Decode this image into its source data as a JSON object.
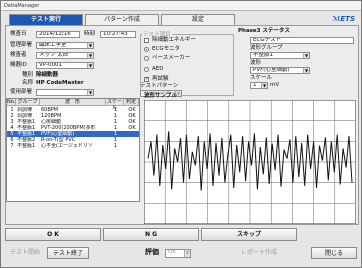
{
  "window": {
    "title": "DeltaManager"
  },
  "tabs": [
    {
      "label": "テスト実行"
    },
    {
      "label": "パターン作成"
    },
    {
      "label": "設定"
    }
  ],
  "logo": "ℳETS",
  "form": {
    "date_label": "検査日",
    "date": "2014/12/16",
    "time_label": "時刻",
    "time": "10:27:43",
    "place_label": "管理部署",
    "place": "臨床工学室",
    "inspector_label": "検査者",
    "inspector": "メッツ 太郎",
    "device_no_label": "機器ID",
    "device_no": "VP-0001",
    "type_label": "種別",
    "type": "除細動器",
    "name_label": "名称",
    "name": "HP CodeMaster",
    "dept_label": "使用部署",
    "dept": ""
  },
  "test_items": {
    "group_label": "テスト項目",
    "items": [
      {
        "label": "除細動エネルギー",
        "checked": false
      },
      {
        "label": "ECGモニタ",
        "checked": true
      },
      {
        "label": "ペースメーカー",
        "checked": false
      },
      {
        "label": "AED",
        "checked": false
      },
      {
        "label": "再試験",
        "checked": true
      }
    ],
    "pattern_label": "テストパターン",
    "pattern": "全項目詳細"
  },
  "phase3": {
    "title": "Phase3 ステータス",
    "status": "ECGテスト",
    "waveform_group_label": "波形グループ",
    "waveform_group": "不整脈1",
    "waveform_label": "波形",
    "waveform": "PVF(心室細動)",
    "scale_label": "スケール",
    "scale": "1",
    "scale_unit": "mV"
  },
  "waveform_sample_label": "波形サンプル",
  "table": {
    "headers": [
      "No.",
      "グループ",
      "波　形",
      "スケール",
      "判定"
    ],
    "rows": [
      {
        "no": "1",
        "group": "洞調律",
        "wave": "60BPM",
        "scale": "1",
        "result": "OK",
        "selected": false
      },
      {
        "no": "2",
        "group": "洞調律",
        "wave": "120BPM",
        "scale": "1",
        "result": "OK",
        "selected": false
      },
      {
        "no": "3",
        "group": "不整脈1",
        "wave": "心房細動",
        "scale": "1",
        "result": "OK",
        "selected": false
      },
      {
        "no": "4",
        "group": "不整脈1",
        "wave": "PVT-200(200BPM)多形",
        "scale": "1",
        "result": "OK",
        "selected": false
      },
      {
        "no": "5",
        "group": "不整脈1",
        "wave": "PVF(心室細動)",
        "scale": "1",
        "result": "",
        "selected": true
      },
      {
        "no": "6",
        "group": "不整脈2",
        "wave": "R-on-T(型 PVC",
        "scale": "1",
        "result": "",
        "selected": false
      },
      {
        "no": "7",
        "group": "不整脈1",
        "wave": "心不全(エージェドリゾ",
        "scale": "1",
        "result": "",
        "selected": false
      }
    ]
  },
  "buttons": {
    "ok": "O K",
    "ng": "N G",
    "skip": "スキップ"
  },
  "footer": {
    "start": "テスト開始",
    "end": "テスト終了",
    "eval_label": "評価",
    "eval_value": "OK",
    "report": "レポート作成",
    "close": "閉じる"
  },
  "chart_data": {
    "type": "line",
    "title": "",
    "xlabel": "",
    "ylabel": "",
    "grid": true,
    "ylim": [
      -1,
      1
    ],
    "series": [
      {
        "values": [
          0.05,
          0.3,
          -0.2,
          0.4,
          -0.35,
          0.25,
          -0.1,
          0.45,
          -0.4,
          0.2,
          0.0,
          0.35,
          -0.3,
          0.4,
          -0.25,
          0.15,
          -0.05,
          0.38,
          -0.42,
          0.3,
          -0.1,
          0.42,
          -0.35,
          0.28,
          -0.2,
          0.35,
          -0.3,
          0.1,
          0.4,
          -0.38,
          0.25,
          -0.15,
          0.38,
          -0.28,
          0.3,
          -0.05,
          0.42,
          -0.4,
          0.22,
          -0.18,
          0.36,
          -0.32,
          0.27,
          -0.12,
          0.4,
          -0.36,
          0.18,
          0.05,
          0.33,
          -0.3,
          0.38,
          -0.22,
          0.28,
          -0.35,
          0.4,
          -0.1,
          0.3,
          -0.38,
          0.24,
          0.02,
          0.36,
          -0.27,
          0.3,
          -0.15,
          0.4,
          -0.33,
          0.2,
          -0.08,
          0.38,
          -0.3
        ]
      }
    ]
  }
}
